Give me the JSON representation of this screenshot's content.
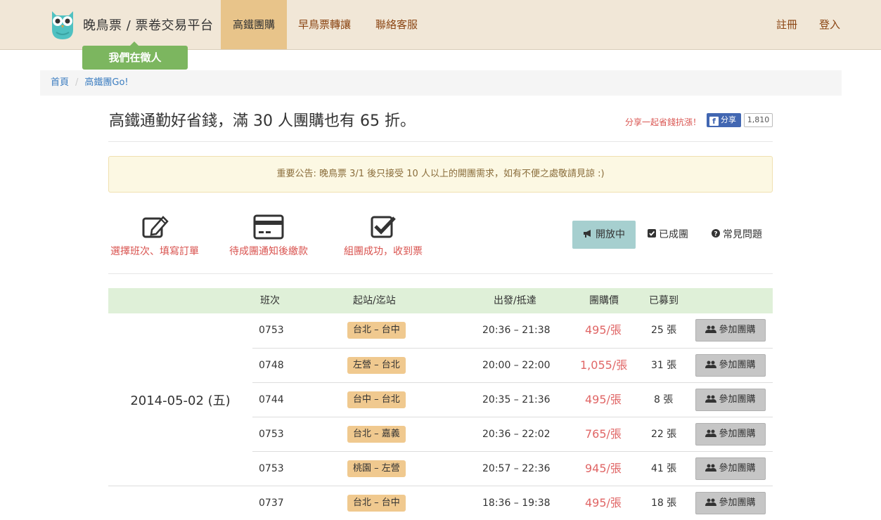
{
  "nav": {
    "brand": "晚鳥票 / 票卷交易平台",
    "items": [
      {
        "label": "高鐵團購",
        "active": true
      },
      {
        "label": "早鳥票轉讓",
        "active": false
      },
      {
        "label": "聯絡客服",
        "active": false
      }
    ],
    "register": "註冊",
    "login": "登入",
    "hiring": "我們在徵人"
  },
  "breadcrumb": {
    "home": "首頁",
    "current": "高鐵團Go!"
  },
  "header": {
    "title": "高鐵通勤好省錢，滿 30 人團購也有 65 折。",
    "share_text": "分享一起省錢抗漲！",
    "fb_label": "分享",
    "fb_count": "1,810"
  },
  "notice": "重要公告: 晚鳥票 3/1 後只接受 10 人以上的開團需求，如有不便之處敬請見諒 :)",
  "steps": [
    {
      "label": "選擇班次、填寫訂單",
      "icon": "edit-icon"
    },
    {
      "label": "待成團通知後繳款",
      "icon": "credit-card-icon"
    },
    {
      "label": "組團成功，收到票",
      "icon": "check-square-icon"
    }
  ],
  "tabs": {
    "open": "開放中",
    "formed": "已成團",
    "faq": "常見問題"
  },
  "table": {
    "headers": {
      "train": "班次",
      "route": "起站/迄站",
      "time": "出發/抵達",
      "price": "團購價",
      "joined": "已募到"
    },
    "date": "2014-05-02 (五)",
    "join_label": "參加團購",
    "rows": [
      {
        "train": "0753",
        "route": "台北 – 台中",
        "time": "20:36 – 21:38",
        "price": "495/張",
        "joined": "25 張"
      },
      {
        "train": "0748",
        "route": "左營 – 台北",
        "time": "20:00 – 22:00",
        "price": "1,055/張",
        "joined": "31 張"
      },
      {
        "train": "0744",
        "route": "台中 – 台北",
        "time": "20:35 – 21:36",
        "price": "495/張",
        "joined": "8 張"
      },
      {
        "train": "0753",
        "route": "台北 – 嘉義",
        "time": "20:36 – 22:02",
        "price": "765/張",
        "joined": "22 張"
      },
      {
        "train": "0753",
        "route": "桃園 – 左營",
        "time": "20:57 – 22:36",
        "price": "945/張",
        "joined": "41 張"
      },
      {
        "train": "0737",
        "route": "台北 – 台中",
        "time": "18:36 – 19:38",
        "price": "495/張",
        "joined": "18 張"
      }
    ]
  }
}
